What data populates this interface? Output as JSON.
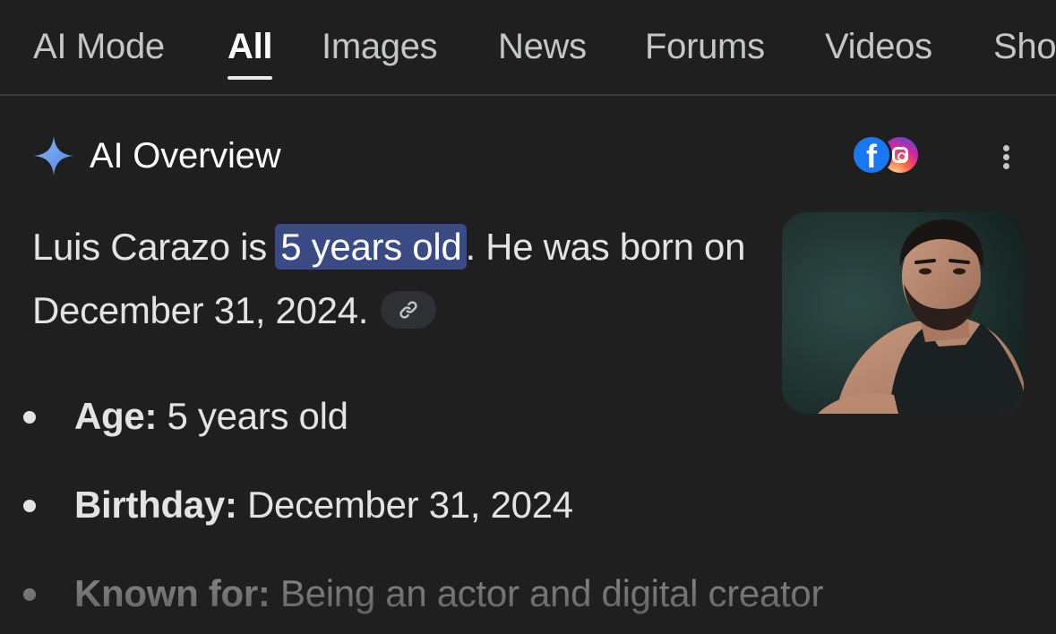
{
  "tabs": [
    {
      "label": "AI Mode"
    },
    {
      "label": "All"
    },
    {
      "label": "Images"
    },
    {
      "label": "News"
    },
    {
      "label": "Forums"
    },
    {
      "label": "Videos"
    },
    {
      "label": "Sho"
    }
  ],
  "active_tab": "All",
  "overview": {
    "title": "AI Overview",
    "sparkle_icon": "sparkle-icon",
    "sources": [
      "facebook-icon",
      "instagram-icon"
    ],
    "more_icon": "more-vert-icon",
    "summary_pre": "Luis Carazo is ",
    "summary_highlight": "5 years old",
    "summary_post": ". He was born on December 31, 2024.",
    "link_icon": "link-icon",
    "highlight_color": "#394a85"
  },
  "facts": [
    {
      "label": "Age:",
      "value": " 5 years old"
    },
    {
      "label": "Birthday:",
      "value": " December 31, 2024"
    },
    {
      "label": "Known for:",
      "value": " Being an actor and digital creator"
    }
  ],
  "colors": {
    "background": "#1f1f1f",
    "text": "#e3e3e3",
    "facebook": "#1877f2",
    "sparkle": "#7aa2f7"
  }
}
